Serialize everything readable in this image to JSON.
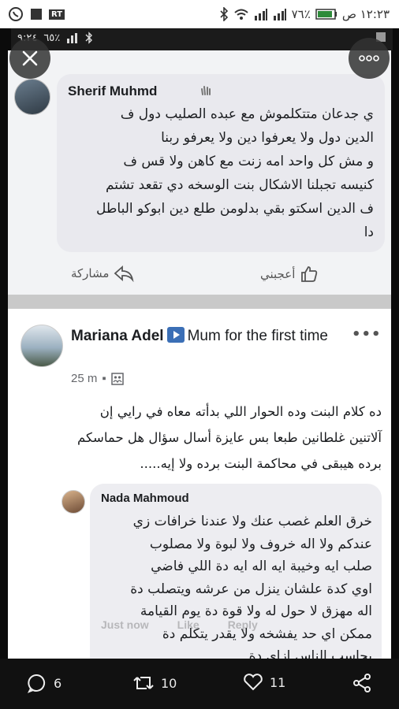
{
  "phone_status": {
    "time": "١٢:٢٣ ص",
    "battery": "٧٦٪",
    "badge": "RT"
  },
  "inner_status": {
    "time": "٩:٢٤",
    "battery": "٦٥٪"
  },
  "comment1": {
    "author": "Sherif Muhmd",
    "text": "ي جدعان متتكلموش مع عبده الصليب دول ف\nالدين دول ولا يعرفوا دين ولا يعرفو ربنا\nو مش كل واحد امه زنت مع كاهن ولا قس ف\nكنيسه تجبلنا الاشكال بنت الوسخه دي تقعد تشتم\nف الدين اسكتو بقي بدلومن طلع دين ابوكو الباطل\nدا",
    "like_label": "أعجبني",
    "share_label": "مشاركة"
  },
  "post": {
    "author": "Mariana Adel",
    "author_suffix": "Mum for the first time",
    "time": "25 m",
    "more_label": "•••",
    "text": "ده كلام البنت وده الحوار اللي بدأته معاه  في رايي إن\nآلاتنين غلطانين طبعا بس عايزة أسال سؤال هل حماسكم\nبرده هيبقى في محاكمة البنت برده ولا إيه....."
  },
  "comment2": {
    "author": "Nada Mahmoud",
    "text": "خرق العلم غصب عنك ولا عندنا خرافات زي\nعندكم ولا اله خروف ولا لبوة ولا مصلوب\nصلب ايه وخيبة ايه اله ايه دة اللي فاضي\nاوي كدة علشان ينزل من عرشه ويتصلب دة\nاله مهزق لا حول له ولا قوة دة يوم القيامة\nممكن اي حد يفشخه ولا يقدر يتكلم دة\nيحاسب الناس ازاي دة",
    "faded_actions": [
      "Just now",
      "Like",
      "Reply"
    ]
  },
  "bottom_nav": {
    "comments": "6",
    "reposts": "10",
    "likes": "11"
  }
}
